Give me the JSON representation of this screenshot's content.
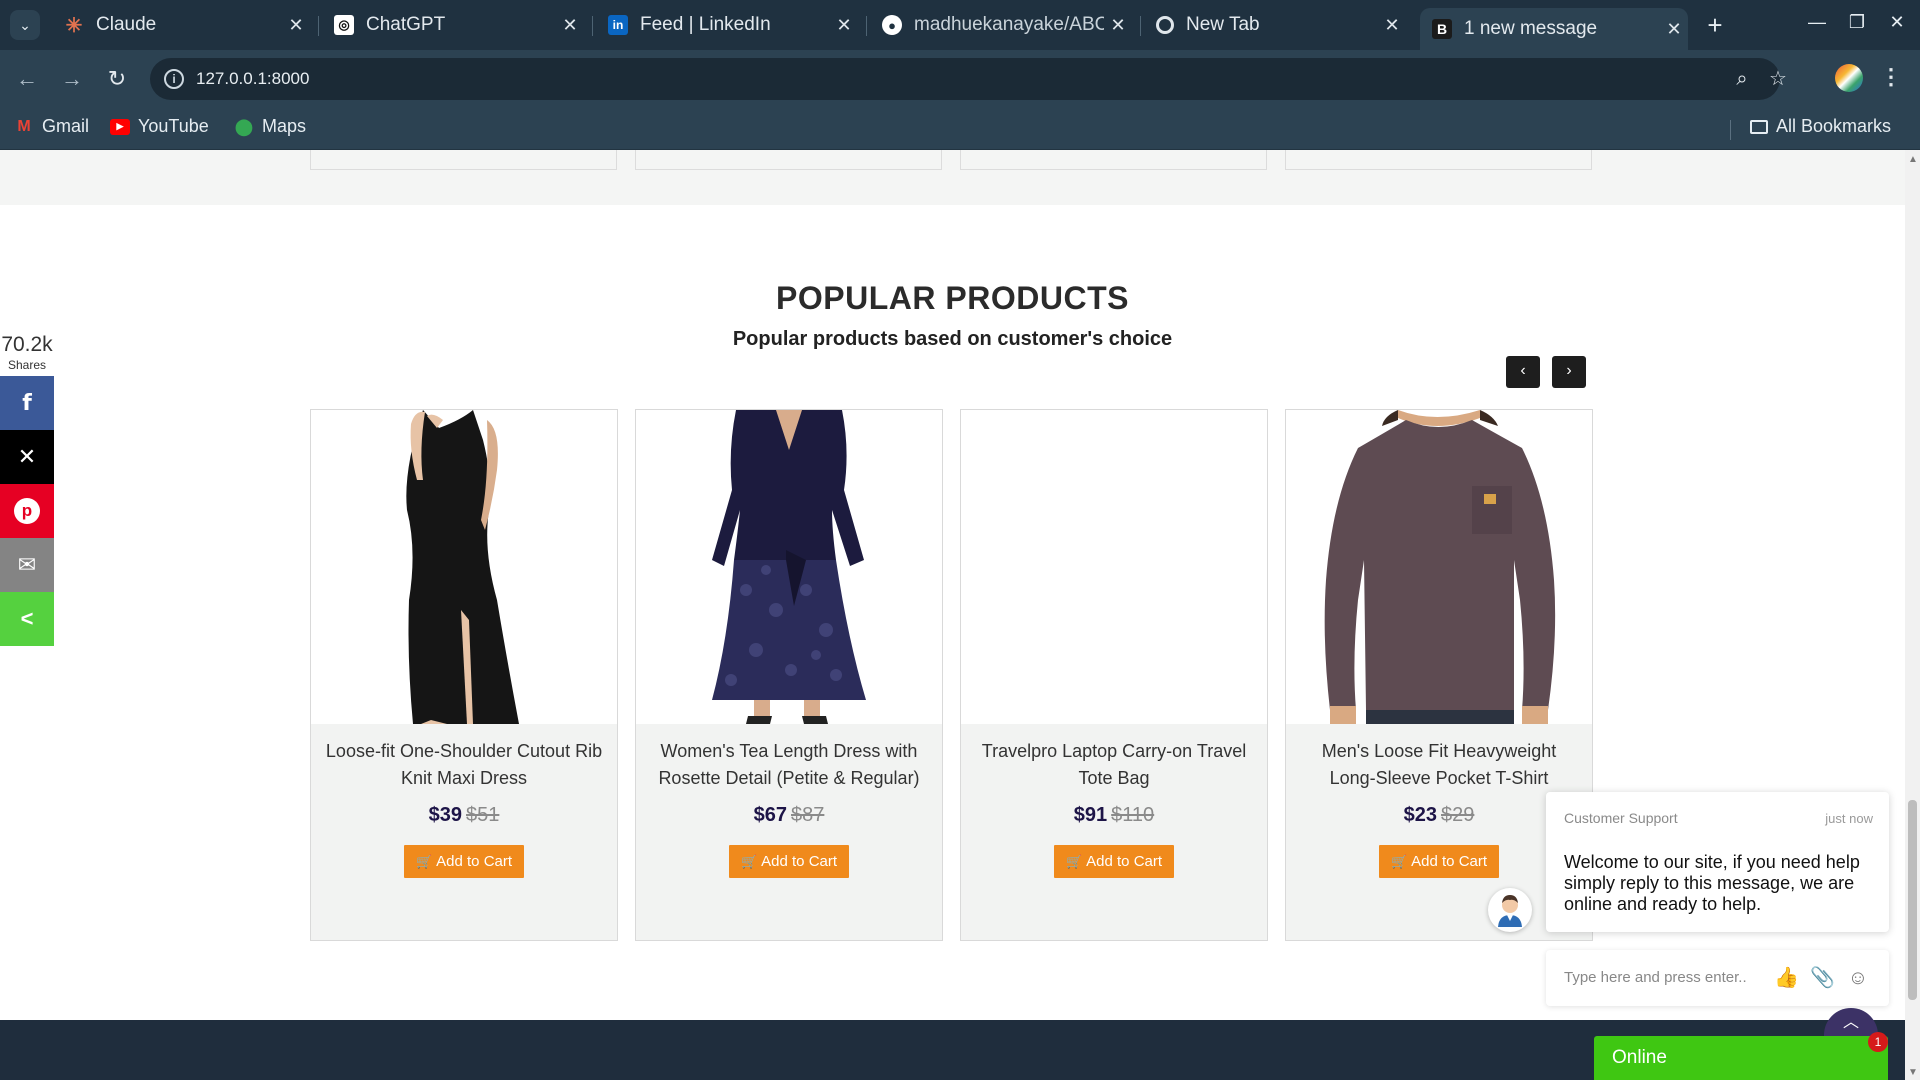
{
  "browser": {
    "tabs": [
      {
        "title": "Claude",
        "icon": "claude-icon",
        "color": "#e0724f"
      },
      {
        "title": "ChatGPT",
        "icon": "chatgpt-icon",
        "color": "#ffffff"
      },
      {
        "title": "Feed | LinkedIn",
        "icon": "linkedin-icon",
        "color": "#0a66c2"
      },
      {
        "title": "madhuekanayake/ABC",
        "icon": "github-icon",
        "color": "#ffffff"
      },
      {
        "title": "New Tab",
        "icon": "chrome-icon",
        "color": "#dfe6eb"
      },
      {
        "title": "1 new message",
        "icon": "b-icon",
        "color": "#1b1b1b"
      }
    ],
    "url": "127.0.0.1:8000",
    "bookmarks": [
      {
        "label": "Gmail",
        "icon": "gmail-icon"
      },
      {
        "label": "YouTube",
        "icon": "youtube-icon"
      },
      {
        "label": "Maps",
        "icon": "maps-icon"
      }
    ],
    "all_bookmarks": "All Bookmarks"
  },
  "section": {
    "title": "POPULAR PRODUCTS",
    "subtitle": "Popular products based on customer's choice",
    "prev_label": "‹",
    "next_label": "›"
  },
  "products": [
    {
      "name": "Loose-fit One-Shoulder Cutout Rib Knit Maxi Dress",
      "price": "$39",
      "old_price": "$51",
      "cart_label": "Add to Cart"
    },
    {
      "name": "Women's Tea Length Dress with Rosette Detail (Petite & Regular)",
      "price": "$67",
      "old_price": "$87",
      "cart_label": "Add to Cart"
    },
    {
      "name": "Travelpro Laptop Carry-on Travel Tote Bag",
      "price": "$91",
      "old_price": "$110",
      "cart_label": "Add to Cart"
    },
    {
      "name": "Men's Loose Fit Heavyweight Long-Sleeve Pocket T-Shirt",
      "price": "$23",
      "old_price": "$29",
      "cart_label": "Add to Cart"
    }
  ],
  "share": {
    "count": "70.2k",
    "label": "Shares",
    "buttons": [
      {
        "name": "facebook",
        "glyph": "f",
        "color": "#3b5998"
      },
      {
        "name": "x",
        "glyph": "𝕏",
        "color": "#000000"
      },
      {
        "name": "pinterest",
        "glyph": "P",
        "color": "#e60023"
      },
      {
        "name": "email",
        "glyph": "✉",
        "color": "#848484"
      },
      {
        "name": "share",
        "glyph": "<",
        "color": "#55d13f"
      }
    ]
  },
  "chat": {
    "sender": "Customer Support",
    "time": "just now",
    "message": "Welcome to our site, if you need help simply reply to this message, we are online and ready to help.",
    "placeholder": "Type here and press enter..",
    "status": "Online",
    "badge": "1"
  },
  "colors": {
    "accent_orange": "#f08a1c",
    "price_navy": "#1d1447",
    "online_green": "#3fc712",
    "footer": "#1f2d3d"
  }
}
